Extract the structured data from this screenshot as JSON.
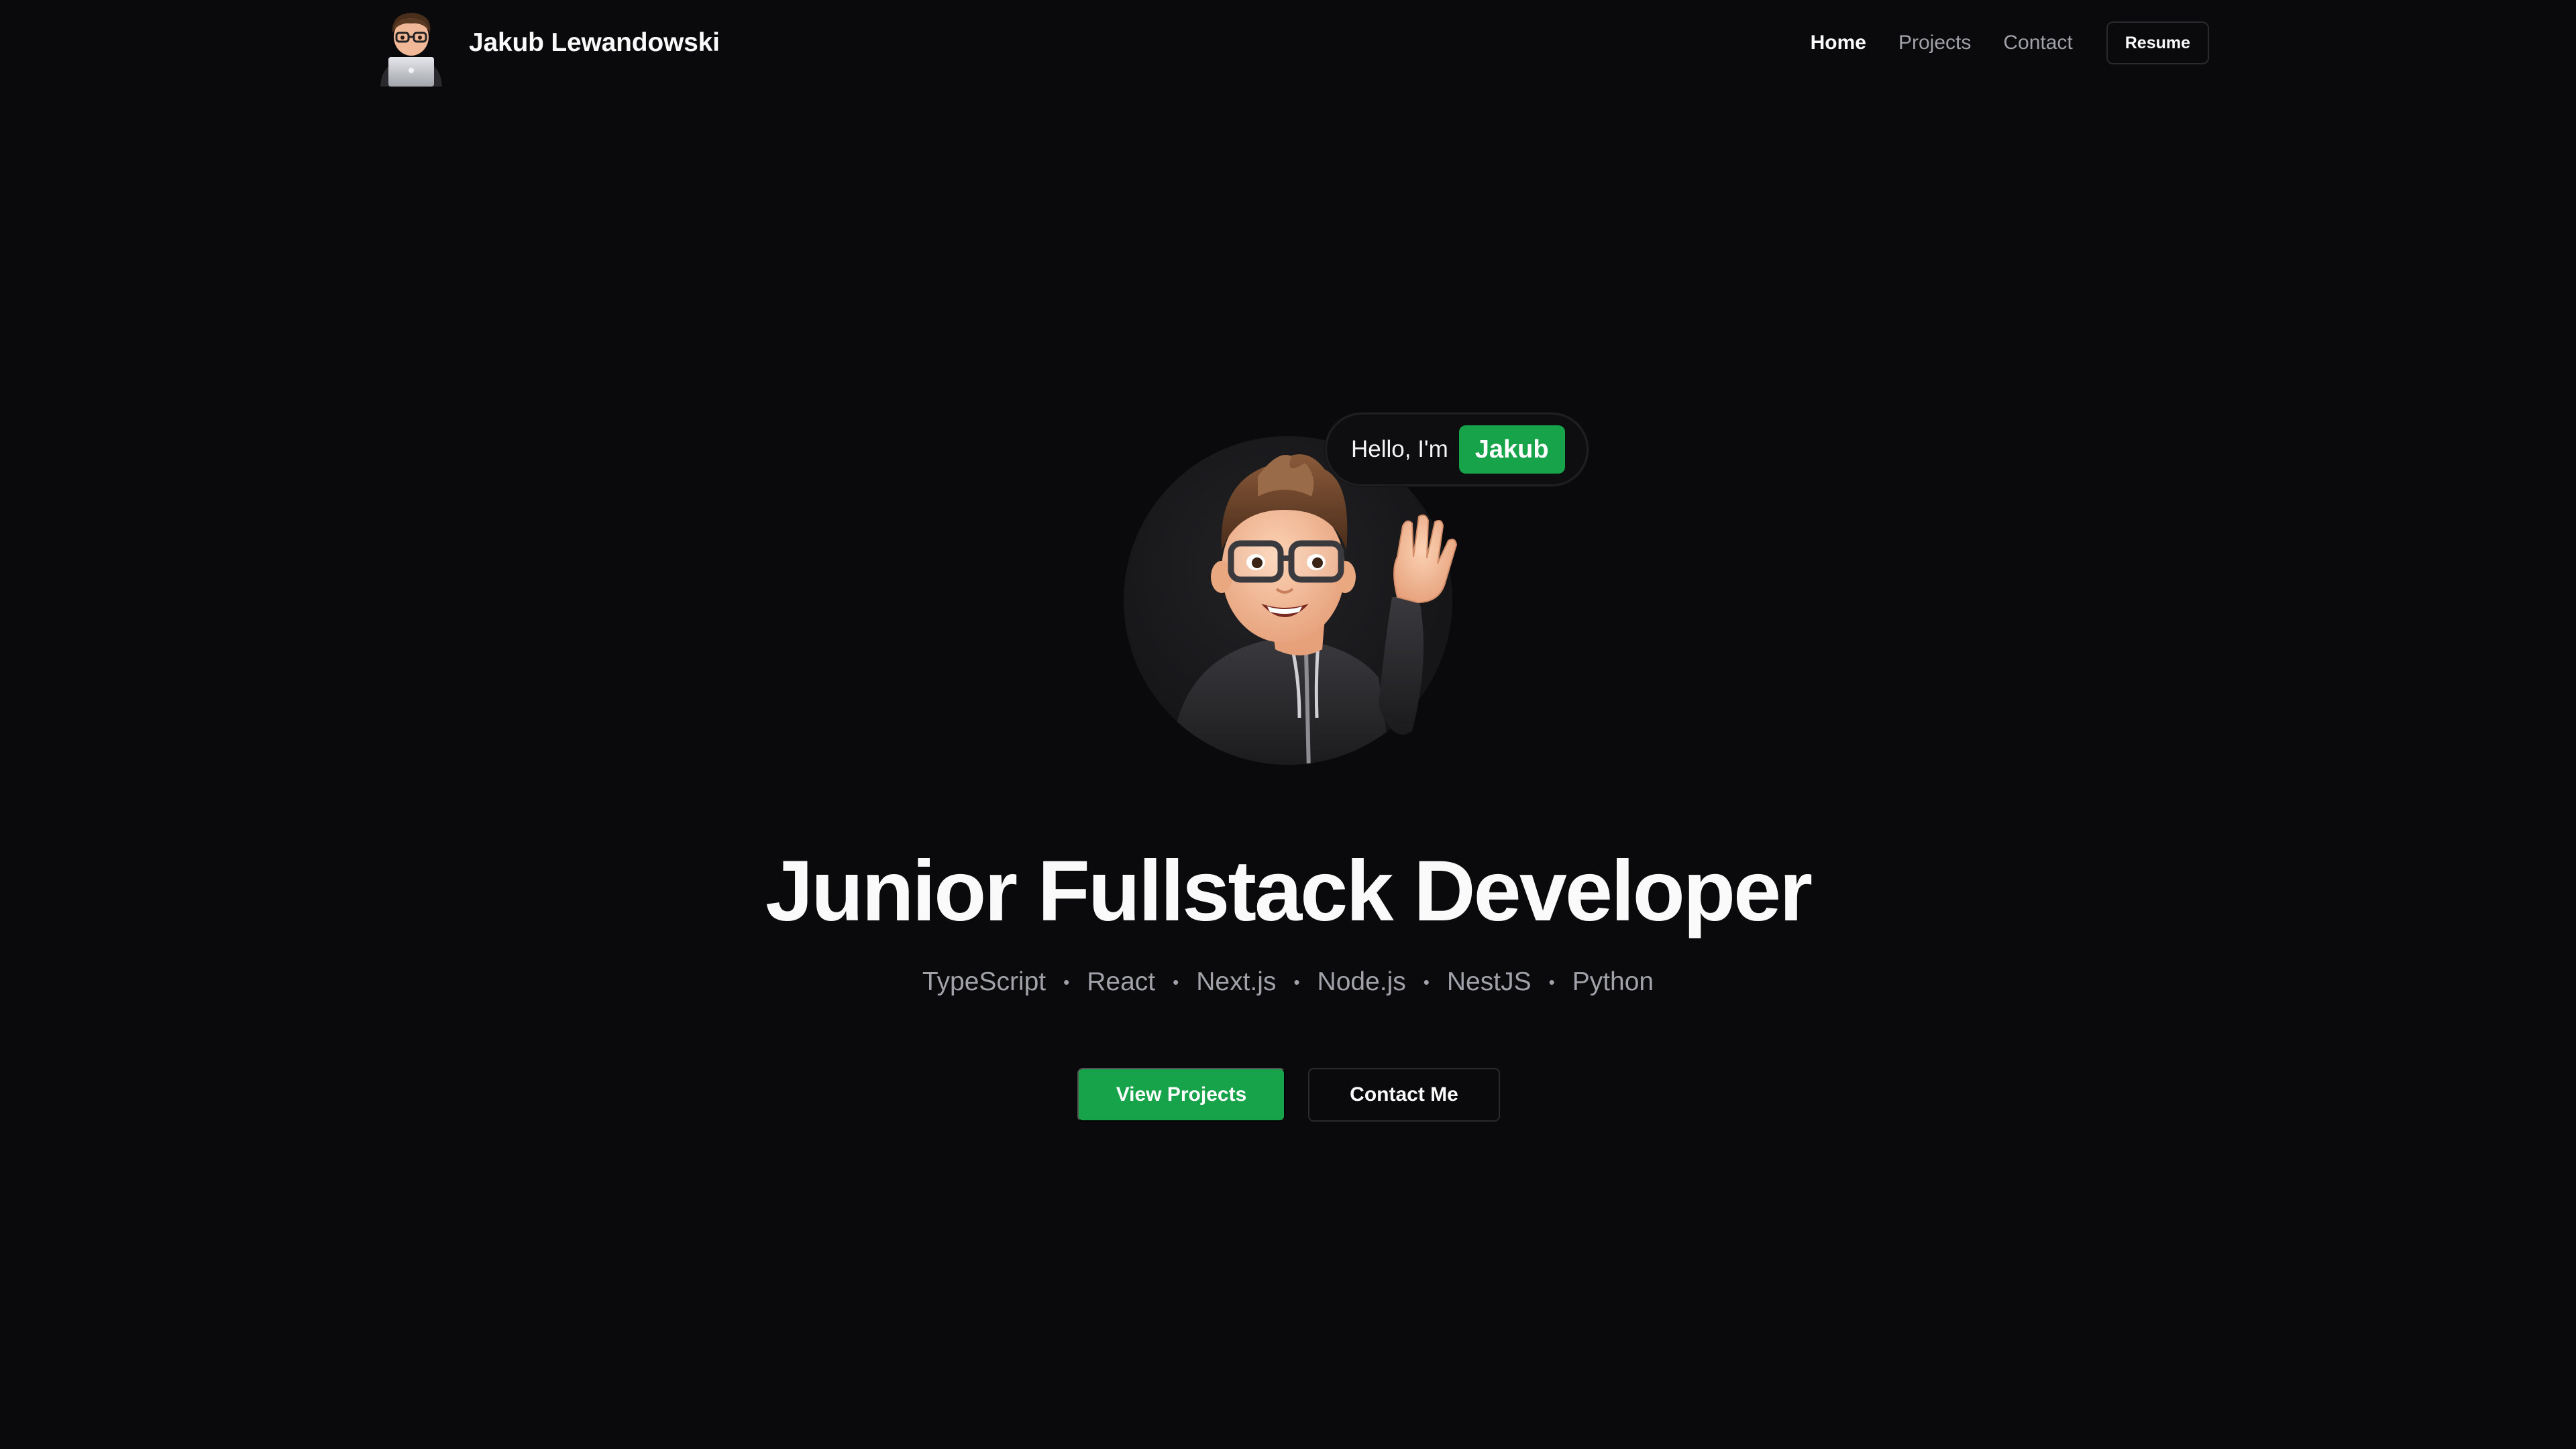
{
  "header": {
    "brand_name": "Jakub Lewandowski",
    "nav": [
      {
        "label": "Home",
        "active": true
      },
      {
        "label": "Projects",
        "active": false
      },
      {
        "label": "Contact",
        "active": false
      }
    ],
    "resume_label": "Resume"
  },
  "hero": {
    "greeting_prefix": "Hello, I'm",
    "greeting_name": "Jakub",
    "headline": "Junior Fullstack Developer",
    "tech": [
      "TypeScript",
      "React",
      "Next.js",
      "Node.js",
      "NestJS",
      "Python"
    ],
    "separator": "•",
    "primary_cta": "View Projects",
    "secondary_cta": "Contact Me"
  },
  "colors": {
    "background": "#0a0a0c",
    "accent": "#16a34a",
    "text": "#fafafa",
    "muted": "#a1a1aa"
  }
}
